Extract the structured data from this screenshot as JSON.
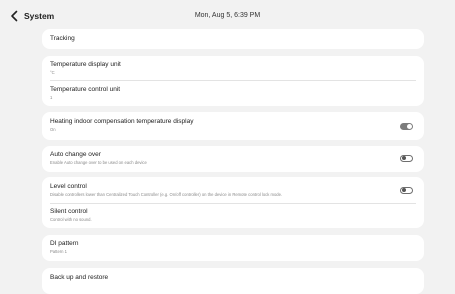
{
  "header": {
    "title": "System",
    "datetime": "Mon, Aug 5, 6:39 PM"
  },
  "settings": {
    "tracking": {
      "label": "Tracking"
    },
    "temp_display": {
      "label": "Temperature display unit",
      "value": "°C"
    },
    "temp_control": {
      "label": "Temperature control unit",
      "value": "1"
    },
    "heating_comp": {
      "label": "Heating indoor compensation temperature display",
      "value": "On",
      "toggle": "on"
    },
    "auto_change": {
      "label": "Auto change over",
      "desc": "Enable Auto change over to be used on each device",
      "toggle": "off"
    },
    "level_control": {
      "label": "Level control",
      "desc": "Disable controllers lower than Centralized Touch Controller (e.g. On/off controller) on the device in Remote control lock mode.",
      "toggle": "off"
    },
    "silent_control": {
      "label": "Silent control",
      "desc": "Control with no sound."
    },
    "di_pattern": {
      "label": "DI pattern",
      "value": "Pattern 1"
    },
    "backup": {
      "label": "Back up and restore"
    }
  },
  "icons": {
    "back": "chevron-left-icon"
  }
}
